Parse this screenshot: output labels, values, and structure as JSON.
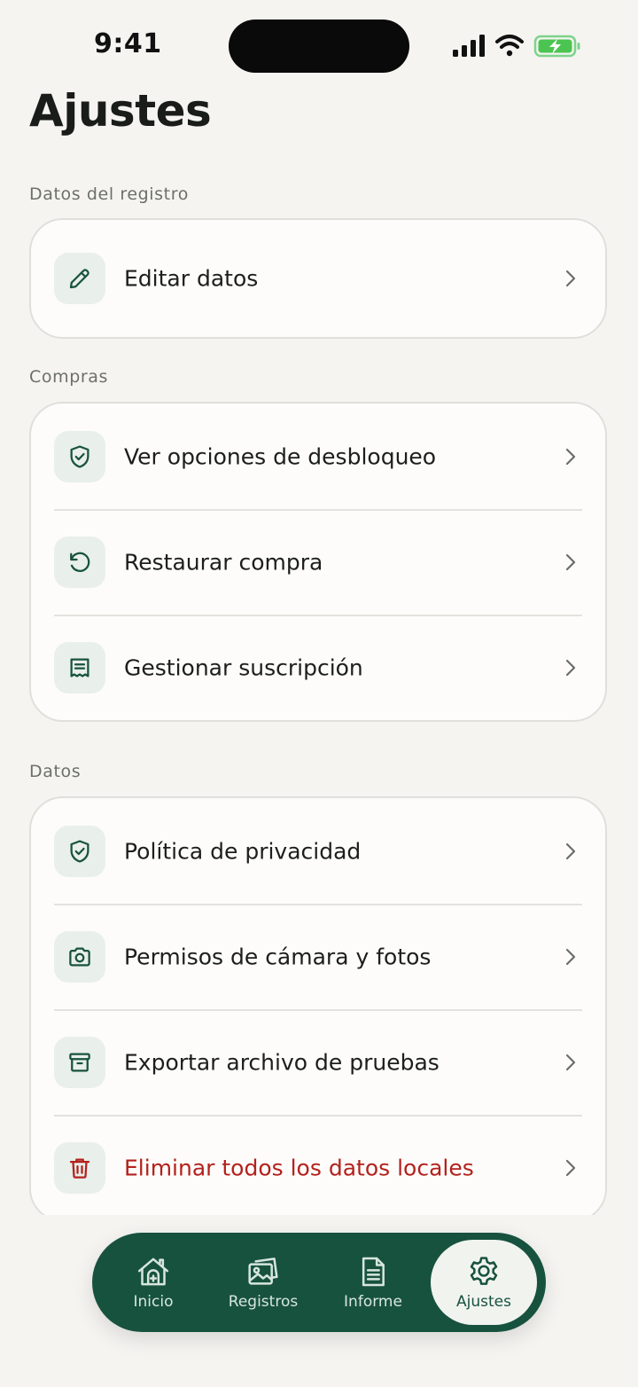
{
  "status": {
    "time": "9:41"
  },
  "header": {
    "title": "Ajustes"
  },
  "sections": [
    {
      "label": "Datos del registro",
      "items": [
        {
          "label": "Editar datos",
          "icon": "pencil-icon"
        }
      ]
    },
    {
      "label": "Compras",
      "items": [
        {
          "label": "Ver opciones de desbloqueo",
          "icon": "shield-check-icon"
        },
        {
          "label": "Restaurar compra",
          "icon": "restore-icon"
        },
        {
          "label": "Gestionar suscripción",
          "icon": "receipt-icon"
        }
      ]
    },
    {
      "label": "Datos",
      "items": [
        {
          "label": "Política de privacidad",
          "icon": "shield-check-icon"
        },
        {
          "label": "Permisos de cámara y fotos",
          "icon": "camera-icon"
        },
        {
          "label": "Exportar archivo de pruebas",
          "icon": "archive-icon"
        },
        {
          "label": "Eliminar todos los datos locales",
          "icon": "trash-icon",
          "danger": true
        }
      ]
    }
  ],
  "tabs": [
    {
      "label": "Inicio",
      "icon": "home-icon",
      "active": false
    },
    {
      "label": "Registros",
      "icon": "photos-icon",
      "active": false
    },
    {
      "label": "Informe",
      "icon": "document-icon",
      "active": false
    },
    {
      "label": "Ajustes",
      "icon": "gear-icon",
      "active": true
    }
  ],
  "colors": {
    "accent": "#17523f",
    "danger": "#b3211c",
    "background": "#f5f4f1",
    "card": "#fdfcfa",
    "icon_tile": "#e9efeb",
    "battery": "#4cc452"
  }
}
